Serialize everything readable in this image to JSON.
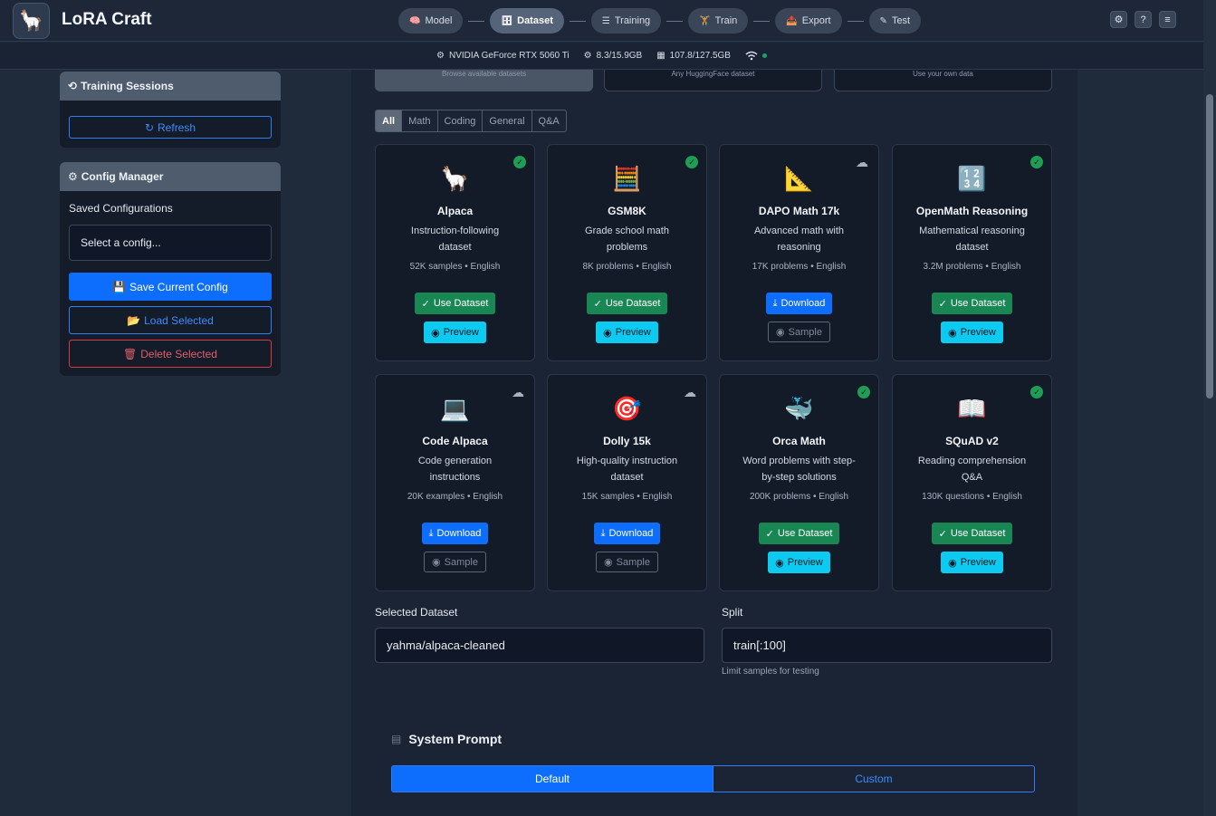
{
  "app": {
    "title": "LoRA Craft",
    "logo_icon": "🦙"
  },
  "steps": [
    {
      "label": "Model",
      "icon": "🧠"
    },
    {
      "label": "Dataset",
      "icon": "🗄"
    },
    {
      "label": "Training",
      "icon": "☰"
    },
    {
      "label": "Train",
      "icon": "🏋"
    },
    {
      "label": "Export",
      "icon": "📤"
    },
    {
      "label": "Test",
      "icon": "✎"
    }
  ],
  "active_step": "Dataset",
  "top_icons": [
    "gear-icon",
    "help-icon",
    "menu-icon"
  ],
  "status": {
    "gpu": "NVIDIA GeForce RTX 5060 Ti",
    "vram": "8.3/15.9GB",
    "ram": "107.8/127.5GB"
  },
  "sidebar": {
    "sessions": {
      "title": "Training Sessions",
      "refresh_label": "Refresh"
    },
    "config": {
      "title": "Config Manager",
      "saved_label": "Saved Configurations",
      "select_placeholder": "Select a config...",
      "save_label": "Save Current Config",
      "load_label": "Load Selected",
      "delete_label": "Delete Selected"
    }
  },
  "sources": [
    {
      "caption": "Browse available datasets"
    },
    {
      "caption": "Any HuggingFace dataset"
    },
    {
      "caption": "Use your own data"
    }
  ],
  "filters": [
    "All",
    "Math",
    "Coding",
    "General",
    "Q&A"
  ],
  "active_filter": "All",
  "datasets": [
    {
      "icon": "🦙",
      "name": "Alpaca",
      "desc": "Instruction-following dataset",
      "meta": "52K samples • English",
      "status": "ready",
      "primary": "Use Dataset",
      "secondary": "Preview"
    },
    {
      "icon": "🧮",
      "name": "GSM8K",
      "desc": "Grade school math problems",
      "meta": "8K problems • English",
      "status": "ready",
      "primary": "Use Dataset",
      "secondary": "Preview"
    },
    {
      "icon": "📐",
      "name": "DAPO Math 17k",
      "desc": "Advanced math with reasoning",
      "meta": "17K problems • English",
      "status": "download",
      "primary": "Download",
      "secondary": "Sample"
    },
    {
      "icon": "🔢",
      "name": "OpenMath Reasoning",
      "desc": "Mathematical reasoning dataset",
      "meta": "3.2M problems • English",
      "status": "ready",
      "primary": "Use Dataset",
      "secondary": "Preview"
    },
    {
      "icon": "💻",
      "name": "Code Alpaca",
      "desc": "Code generation instructions",
      "meta": "20K examples • English",
      "status": "download",
      "primary": "Download",
      "secondary": "Sample"
    },
    {
      "icon": "🎯",
      "name": "Dolly 15k",
      "desc": "High-quality instruction dataset",
      "meta": "15K samples • English",
      "status": "download",
      "primary": "Download",
      "secondary": "Sample"
    },
    {
      "icon": "🐳",
      "name": "Orca Math",
      "desc": "Word problems with step-by-step solutions",
      "meta": "200K problems • English",
      "status": "ready",
      "primary": "Use Dataset",
      "secondary": "Preview"
    },
    {
      "icon": "📖",
      "name": "SQuAD v2",
      "desc": "Reading comprehension Q&A",
      "meta": "130K questions • English",
      "status": "ready",
      "primary": "Use Dataset",
      "secondary": "Preview"
    }
  ],
  "selected": {
    "dataset_label": "Selected Dataset",
    "dataset_value": "yahma/alpaca-cleaned",
    "split_label": "Split",
    "split_value": "train[:100]",
    "split_hint": "Limit samples for testing"
  },
  "system_prompt": {
    "title": "System Prompt",
    "options": [
      "Default",
      "Custom"
    ],
    "active": "Default"
  },
  "colors": {
    "accent": "#0d6efd",
    "success": "#198754",
    "info": "#0dcaf0",
    "danger": "#dc3545"
  }
}
